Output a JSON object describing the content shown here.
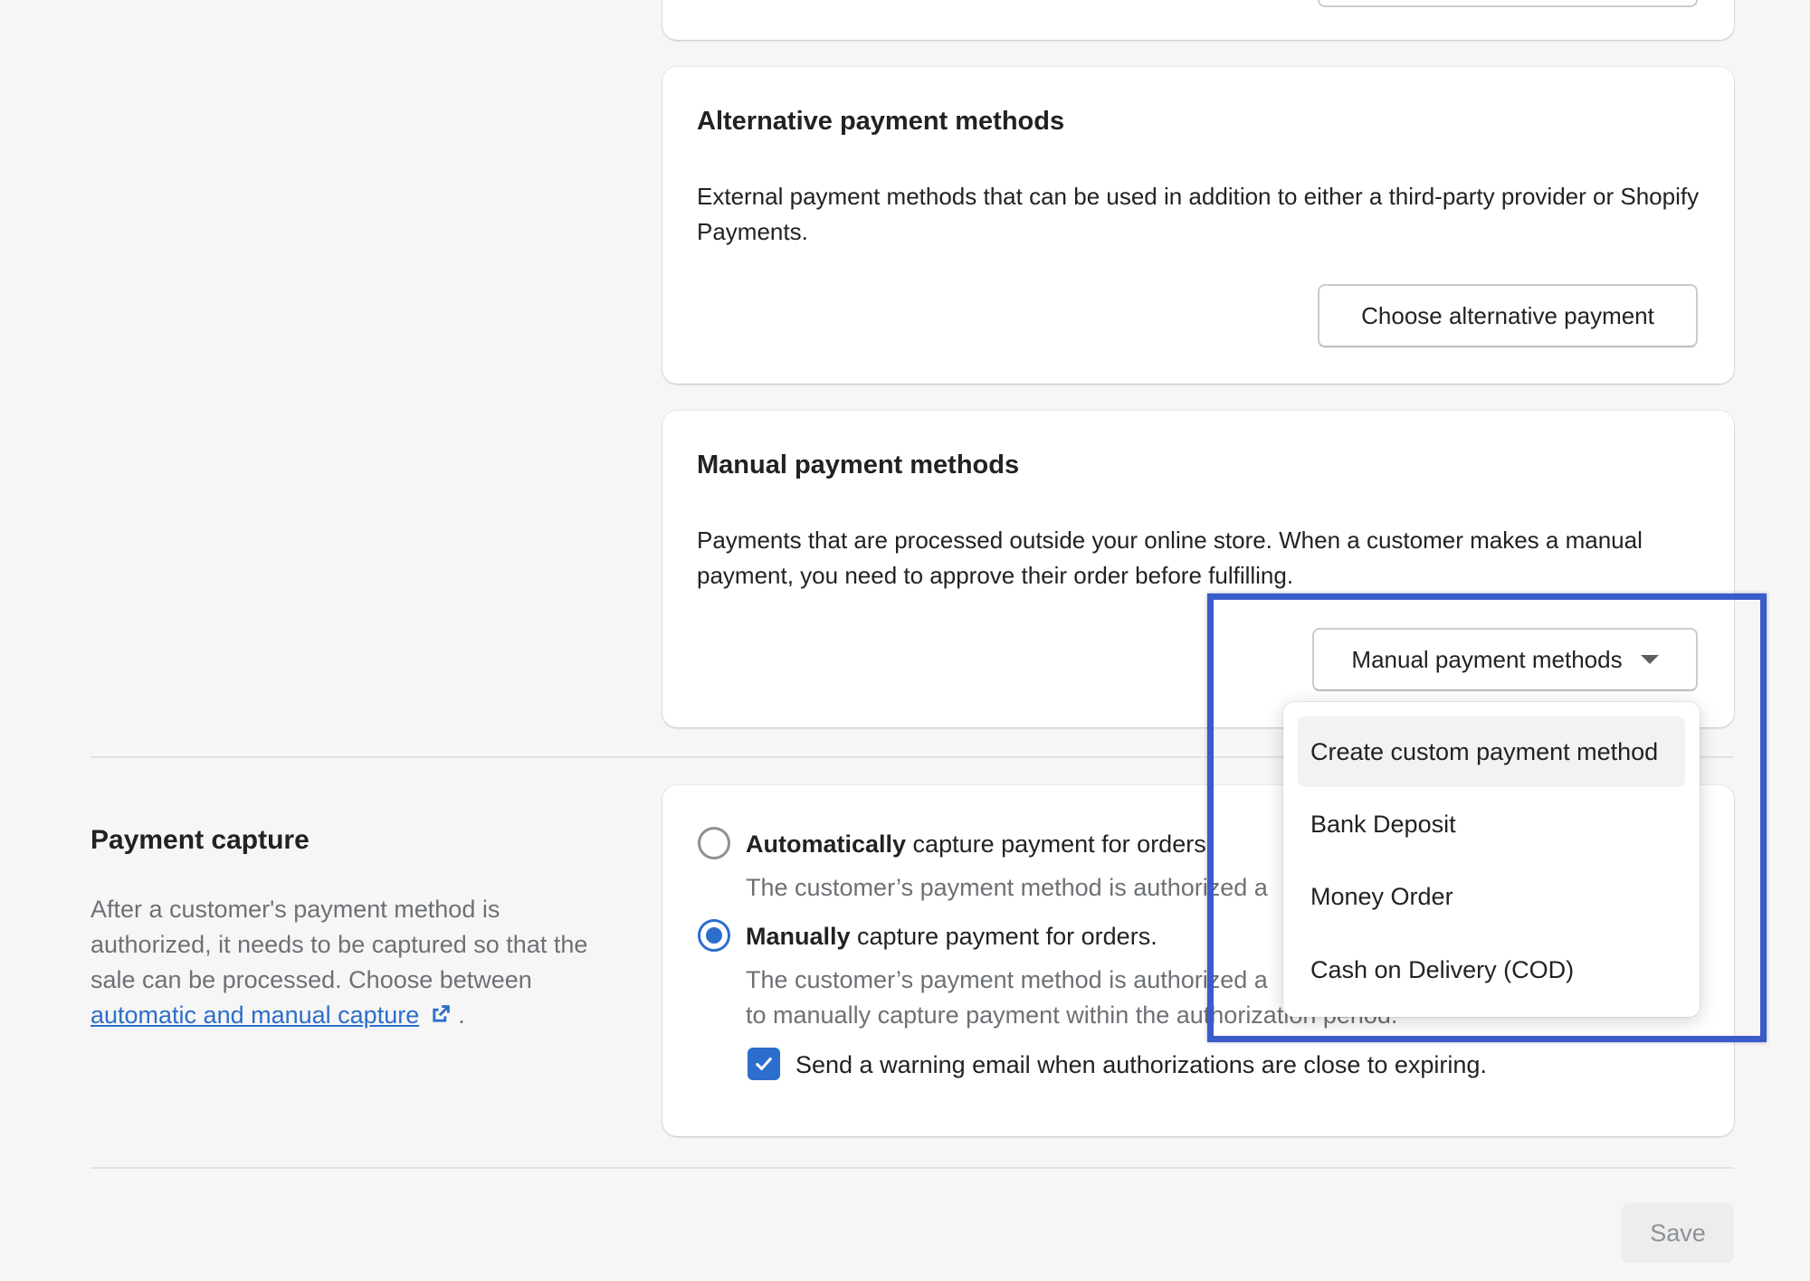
{
  "cards": {
    "alternative": {
      "title": "Alternative payment methods",
      "description": "External payment methods that can be used in addition to either a third-party provider or Shopify Payments.",
      "button_label": "Choose alternative payment"
    },
    "manual": {
      "title": "Manual payment methods",
      "description": "Payments that are processed outside your online store. When a customer makes a manual payment, you need to approve their order before fulfilling.",
      "button_label": "Manual payment methods"
    }
  },
  "dropdown": {
    "items": [
      {
        "label": "Create custom payment method"
      },
      {
        "label": "Bank Deposit"
      },
      {
        "label": "Money Order"
      },
      {
        "label": "Cash on Delivery (COD)"
      }
    ]
  },
  "payment_capture": {
    "title": "Payment capture",
    "description": "After a customer's payment method is authorized, it needs to be captured so that the sale can be processed. Choose between",
    "link_text": "automatic and manual capture",
    "link_suffix": ".",
    "options": {
      "automatic": {
        "bold": "Automatically",
        "rest": " capture payment for orders.",
        "help": "The customer’s payment method is authorized a",
        "selected": false
      },
      "manual": {
        "bold": "Manually",
        "rest": " capture payment for orders.",
        "help_line1": "The customer’s payment method is authorized a",
        "help_line2": "to manually capture payment within the authorization period.",
        "selected": true
      }
    },
    "warning_checkbox": {
      "label": "Send a warning email when authorizations are close to expiring.",
      "checked": true
    }
  },
  "footer": {
    "save_label": "Save"
  },
  "colors": {
    "background": "#f6f6f6",
    "accent": "#2c6ecb",
    "highlight_border": "#3b5bc9"
  }
}
